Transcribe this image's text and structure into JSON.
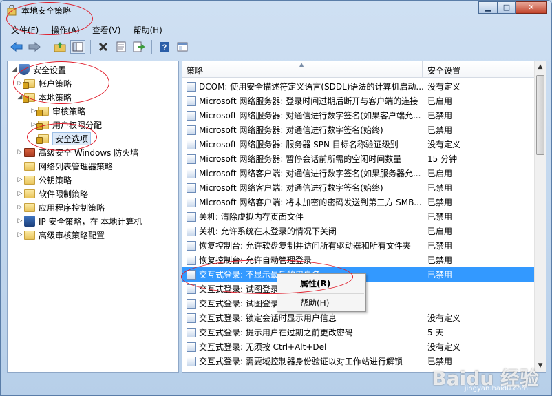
{
  "window": {
    "title": "本地安全策略"
  },
  "menu": [
    {
      "label": "文件(F)"
    },
    {
      "label": "操作(A)"
    },
    {
      "label": "查看(V)"
    },
    {
      "label": "帮助(H)"
    }
  ],
  "toolbar": [
    "back-arrow-icon",
    "forward-arrow-icon",
    "up-folder-icon",
    "show-tree-icon",
    "delete-icon",
    "properties-icon",
    "export-icon",
    "help-icon",
    "console-icon"
  ],
  "tree": [
    {
      "label": "安全设置",
      "level": 0,
      "expanded": true,
      "icon": "shield"
    },
    {
      "label": "帐户策略",
      "level": 1,
      "expanded": false,
      "icon": "lock-folder"
    },
    {
      "label": "本地策略",
      "level": 1,
      "expanded": true,
      "icon": "lock-folder"
    },
    {
      "label": "审核策略",
      "level": 2,
      "expanded": false,
      "icon": "lock-folder"
    },
    {
      "label": "用户权限分配",
      "level": 2,
      "expanded": false,
      "icon": "lock-folder"
    },
    {
      "label": "安全选项",
      "level": 2,
      "expanded": null,
      "icon": "lock-folder",
      "selected": true
    },
    {
      "label": "高级安全 Windows 防火墙",
      "level": 1,
      "expanded": false,
      "icon": "firewall"
    },
    {
      "label": "网络列表管理器策略",
      "level": 1,
      "expanded": null,
      "icon": "folder"
    },
    {
      "label": "公钥策略",
      "level": 1,
      "expanded": false,
      "icon": "folder"
    },
    {
      "label": "软件限制策略",
      "level": 1,
      "expanded": false,
      "icon": "folder"
    },
    {
      "label": "应用程序控制策略",
      "level": 1,
      "expanded": false,
      "icon": "folder"
    },
    {
      "label": "IP 安全策略，在 本地计算机",
      "level": 1,
      "expanded": false,
      "icon": "ipsec"
    },
    {
      "label": "高级审核策略配置",
      "level": 1,
      "expanded": false,
      "icon": "folder"
    }
  ],
  "list": {
    "columns": {
      "policy": "策略",
      "setting": "安全设置"
    },
    "rows": [
      {
        "policy": "DCOM: 使用安全描述符定义语言(SDDL)语法的计算机启动...",
        "setting": "没有定义"
      },
      {
        "policy": "Microsoft 网络服务器: 登录时间过期后断开与客户端的连接",
        "setting": "已启用"
      },
      {
        "policy": "Microsoft 网络服务器: 对通信进行数字签名(如果客户端允...",
        "setting": "已禁用"
      },
      {
        "policy": "Microsoft 网络服务器: 对通信进行数字签名(始终)",
        "setting": "已禁用"
      },
      {
        "policy": "Microsoft 网络服务器: 服务器 SPN 目标名称验证级别",
        "setting": "没有定义"
      },
      {
        "policy": "Microsoft 网络服务器: 暂停会话前所需的空闲时间数量",
        "setting": "15 分钟"
      },
      {
        "policy": "Microsoft 网络客户端: 对通信进行数字签名(如果服务器允...",
        "setting": "已启用"
      },
      {
        "policy": "Microsoft 网络客户端: 对通信进行数字签名(始终)",
        "setting": "已禁用"
      },
      {
        "policy": "Microsoft 网络客户端: 将未加密的密码发送到第三方 SMB...",
        "setting": "已禁用"
      },
      {
        "policy": "关机: 清除虚拟内存页面文件",
        "setting": "已禁用"
      },
      {
        "policy": "关机: 允许系统在未登录的情况下关闭",
        "setting": "已启用"
      },
      {
        "policy": "恢复控制台: 允许软盘复制并访问所有驱动器和所有文件夹",
        "setting": "已禁用"
      },
      {
        "policy": "恢复控制台: 允许自动管理登录",
        "setting": "已禁用"
      },
      {
        "policy": "交互式登录: 不显示最后的用户名",
        "setting": "已禁用",
        "selected": true
      },
      {
        "policy": "交互式登录: 试图登录",
        "setting": ""
      },
      {
        "policy": "交互式登录: 试图登录",
        "setting": ""
      },
      {
        "policy": "交互式登录: 锁定会话时显示用户信息",
        "setting": "没有定义"
      },
      {
        "policy": "交互式登录: 提示用户在过期之前更改密码",
        "setting": "5 天"
      },
      {
        "policy": "交互式登录: 无须按 Ctrl+Alt+Del",
        "setting": "没有定义"
      },
      {
        "policy": "交互式登录: 需要域控制器身份验证以对工作站进行解锁",
        "setting": "已禁用"
      }
    ]
  },
  "context_menu": {
    "properties": "属性(R)",
    "help": "帮助(H)"
  },
  "watermark": {
    "main": "Baidu 经验",
    "sub": "jingyan.baidu.com"
  }
}
